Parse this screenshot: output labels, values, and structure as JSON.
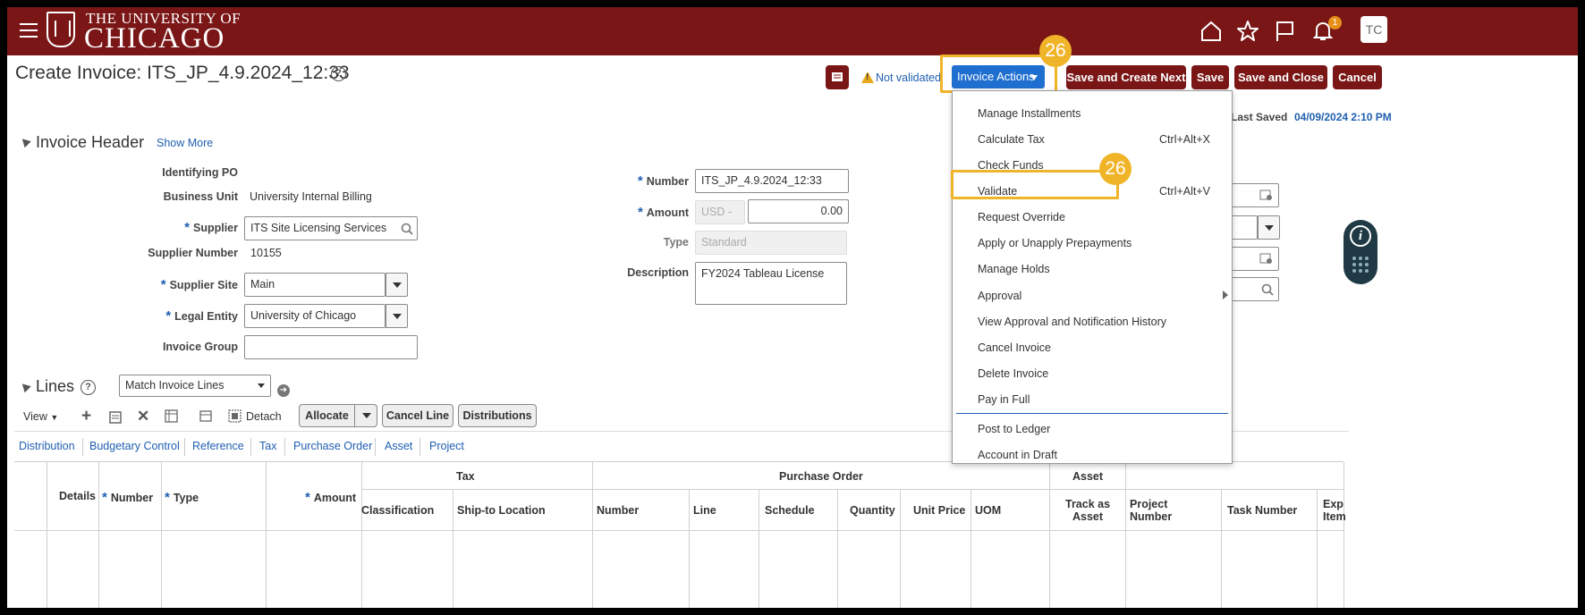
{
  "header": {
    "logo_top": "THE UNIVERSITY OF",
    "logo_main": "CHICAGO",
    "icons": [
      "menu-icon",
      "home-icon",
      "star-icon",
      "flag-icon",
      "bell-icon"
    ],
    "notification_count": "1",
    "avatar_initials": "TC"
  },
  "page": {
    "title": "Create Invoice: ITS_JP_4.9.2024_12:33",
    "help_glyph": "?",
    "status_text": "Not validated",
    "invoice_actions_label": "Invoice Actions",
    "buttons": {
      "save_create_next": "Save and Create Next",
      "save": "Save",
      "save_close": "Save and Close",
      "cancel": "Cancel"
    },
    "last_saved_label": "Last Saved",
    "last_saved_value": "04/09/2024 2:10 PM"
  },
  "callouts": {
    "step_1": "26",
    "step_2": "26"
  },
  "invoice_header": {
    "title": "Invoice Header",
    "show_more": "Show More",
    "fields": {
      "identifying_po_label": "Identifying PO",
      "business_unit_label": "Business Unit",
      "business_unit_value": "University Internal Billing",
      "supplier_label": "Supplier",
      "supplier_value": "ITS Site Licensing Services",
      "supplier_number_label": "Supplier Number",
      "supplier_number_value": "10155",
      "supplier_site_label": "Supplier Site",
      "supplier_site_value": "Main",
      "legal_entity_label": "Legal Entity",
      "legal_entity_value": "University of Chicago",
      "invoice_group_label": "Invoice Group",
      "invoice_group_value": "",
      "number_label": "Number",
      "number_value": "ITS_JP_4.9.2024_12:33",
      "amount_label": "Amount",
      "currency_value": "USD -",
      "amount_value": "0.00",
      "type_label": "Type",
      "type_value": "Standard",
      "description_label": "Description",
      "description_value": "FY2024 Tableau License"
    }
  },
  "actions_menu": {
    "items": [
      {
        "label": "Manage Installments",
        "shortcut": ""
      },
      {
        "label": "Calculate Tax",
        "shortcut": "Ctrl+Alt+X"
      },
      {
        "label": "Check Funds",
        "shortcut": ""
      },
      {
        "label": "Validate",
        "shortcut": "Ctrl+Alt+V"
      },
      {
        "label": "Request Override",
        "shortcut": ""
      },
      {
        "label": "Apply or Unapply Prepayments",
        "shortcut": ""
      },
      {
        "label": "Manage Holds",
        "shortcut": ""
      },
      {
        "label": "Approval",
        "shortcut": ""
      },
      {
        "label": "View Approval and Notification History",
        "shortcut": ""
      },
      {
        "label": "Cancel Invoice",
        "shortcut": ""
      },
      {
        "label": "Delete Invoice",
        "shortcut": ""
      },
      {
        "label": "Pay in Full",
        "shortcut": ""
      },
      {
        "label": "Post to Ledger",
        "shortcut": ""
      },
      {
        "label": "Account in Draft",
        "shortcut": ""
      }
    ]
  },
  "lines": {
    "title": "Lines",
    "match_select_value": "Match Invoice Lines",
    "view_label": "View",
    "detach_label": "Detach",
    "allocate_label": "Allocate",
    "cancel_line_label": "Cancel Line",
    "distributions_label": "Distributions",
    "tabs": [
      "Distribution",
      "Budgetary Control",
      "Reference",
      "Tax",
      "Purchase Order",
      "Asset",
      "Project"
    ],
    "group_headers": {
      "tax": "Tax",
      "purchase_order": "Purchase Order",
      "asset": "Asset"
    },
    "columns": {
      "details": "Details",
      "number": "Number",
      "type": "Type",
      "amount": "Amount",
      "classification": "Classification",
      "ship_to": "Ship-to Location",
      "po_number": "Number",
      "line": "Line",
      "schedule": "Schedule",
      "quantity": "Quantity",
      "unit_price": "Unit Price",
      "uom": "UOM",
      "track_as": "Track as",
      "asset": "Asset",
      "project": "Project",
      "project_number": "Number",
      "task_number": "Task Number",
      "exp": "Exp",
      "item": "Item"
    }
  },
  "colors": {
    "brand": "#7a1616",
    "accent_blue": "#1f6fd1",
    "callout": "#f0b429",
    "link": "#1f5fb0"
  }
}
